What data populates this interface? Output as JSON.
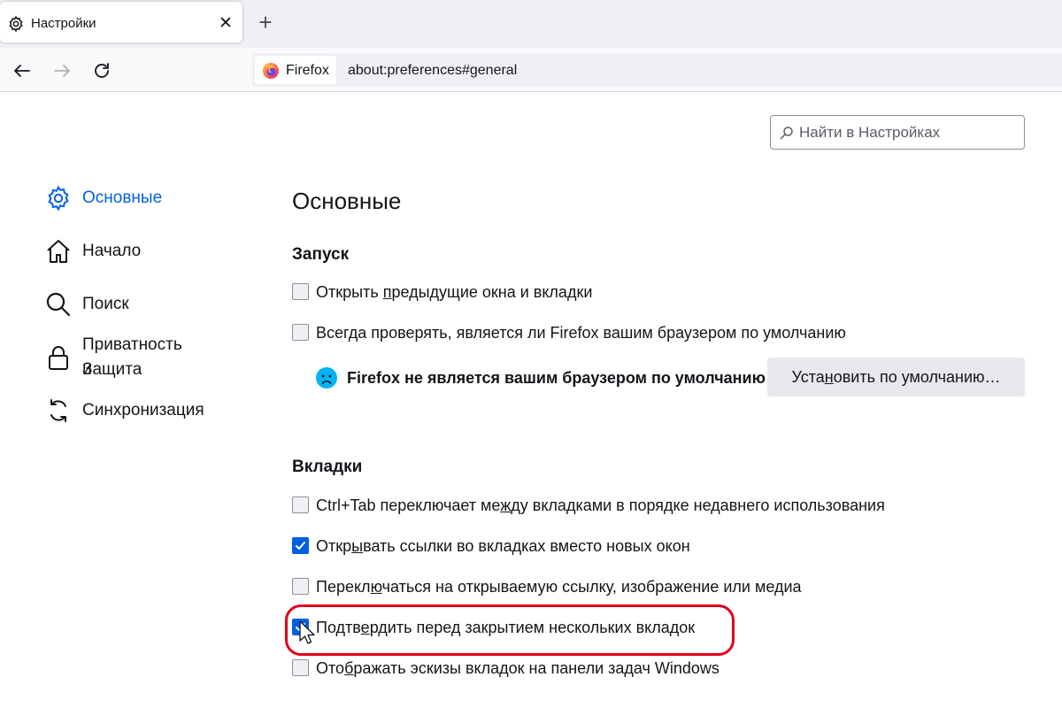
{
  "tab": {
    "title": "Настройки",
    "close_glyph": "✕",
    "icon": "gear-icon"
  },
  "newtab": {
    "glyph": "+"
  },
  "nav": {
    "back_icon": "back-arrow-icon",
    "forward_icon": "forward-arrow-icon",
    "reload_icon": "reload-icon"
  },
  "urlbar": {
    "identity_label": "Firefox",
    "url": "about:preferences#general"
  },
  "search": {
    "placeholder": "Найти в Настройках"
  },
  "sidebar": {
    "items": [
      {
        "label": "Основные",
        "icon": "gear-icon",
        "active": true
      },
      {
        "label": "Начало",
        "icon": "home-icon"
      },
      {
        "label": "Поиск",
        "icon": "search-icon"
      },
      {
        "label_line1": "Приватность и",
        "label_line2": "Защита",
        "icon": "lock-icon"
      },
      {
        "label": "Синхронизация",
        "icon": "sync-icon"
      }
    ]
  },
  "main": {
    "title": "Основные",
    "startup": {
      "heading": "Запуск",
      "restore": {
        "pre": "Открыть ",
        "u": "п",
        "post": "редыдущие окна и вкладки",
        "checked": false
      },
      "check_default": {
        "pre": "Всег",
        "u": "д",
        "post": "а проверять, является ли Firefox вашим браузером по умолчанию",
        "checked": false
      },
      "not_default_msg": "Firefox не является вашим браузером по умолчанию",
      "set_default_btn": {
        "pre": "Уста",
        "u": "н",
        "post": "овить по умолчанию…"
      }
    },
    "tabs": {
      "heading": "Вкладки",
      "items": [
        {
          "pre": "Ctrl+Tab переключает ме",
          "u": "ж",
          "post": "ду вкладками в порядке недавнего использования",
          "checked": false
        },
        {
          "pre": "Откр",
          "u": "ы",
          "post": "вать ссылки во вкладках вместо новых окон",
          "checked": true
        },
        {
          "pre": "Перекл",
          "u": "ю",
          "post": "чаться на открываемую ссылку, изображение или медиа",
          "checked": false
        },
        {
          "pre": "Подтв",
          "u": "е",
          "post": "рдить перед закрытием нескольких вкладок",
          "checked": true
        },
        {
          "pre": "Ото",
          "u": "б",
          "post": "ражать эскизы вкладок на панели задач Windows",
          "checked": false
        }
      ]
    }
  },
  "colors": {
    "accent": "#0061e0",
    "highlight": "#e0001b",
    "tabstrip": "#f0f0f4"
  }
}
